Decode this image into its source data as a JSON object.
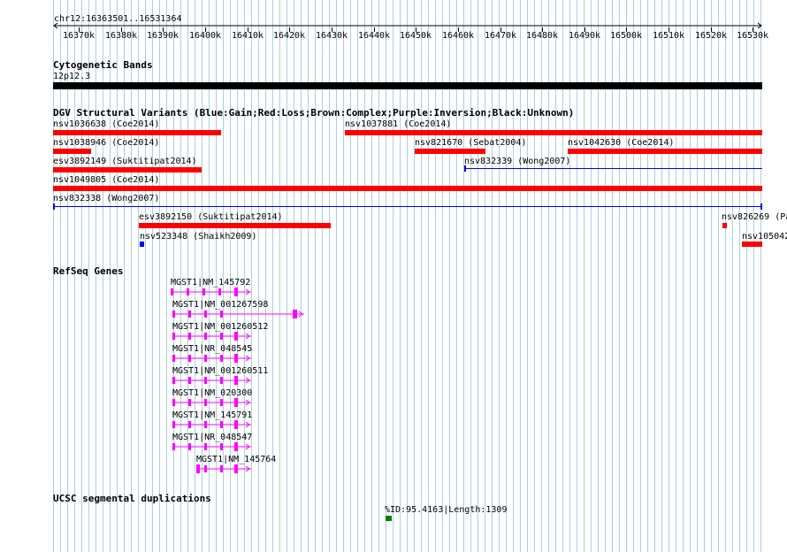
{
  "ruler": {
    "position": "chr12:16363501..16531364",
    "ticks": [
      "16370k",
      "16380k",
      "16390k",
      "16400k",
      "16410k",
      "16420k",
      "16430k",
      "16440k",
      "16450k",
      "16460k",
      "16470k",
      "16480k",
      "16490k",
      "16500k",
      "16510k",
      "16520k",
      "16530k"
    ]
  },
  "cytobands": {
    "title": "Cytogenetic Bands",
    "band": "12p12.3"
  },
  "dgv": {
    "title": "DGV Structural Variants (Blue:Gain;Red:Loss;Brown:Complex;Purple:Inversion;Black:Unknown)",
    "variants": [
      "nsv1036638 (Coe2014)",
      "nsv1037881 (Coe2014)",
      "nsv1038946 (Coe2014)",
      "nsv821670 (Sebat2004)",
      "nsv1042630 (Coe2014)",
      "esv3892149 (Suktitipat2014)",
      "nsv832339 (Wong2007)",
      "nsv1049805 (Coe2014)",
      "nsv832338 (Wong2007)",
      "esv3892150 (Suktitipat2014)",
      "nsv826269 (Pa",
      "nsv523348 (Shaikh2009)",
      "nsv105042"
    ]
  },
  "refseq": {
    "title": "RefSeq Genes",
    "genes": [
      "MGST1|NM_145792",
      "MGST1|NM_001267598",
      "MGST1|NM_001260512",
      "MGST1|NR_048545",
      "MGST1|NM_001260511",
      "MGST1|NM_020300",
      "MGST1|NM_145791",
      "MGST1|NR_048547",
      "MGST1|NM_145764"
    ]
  },
  "segdup": {
    "title": "UCSC segmental duplications",
    "item": "%ID:95.4163|Length:1309"
  },
  "colors": {
    "loss": "#ff0000",
    "gain": "#0000ff",
    "gene": "#ff00ff",
    "segdup": "#008000",
    "grid": "#a9cfe0"
  }
}
